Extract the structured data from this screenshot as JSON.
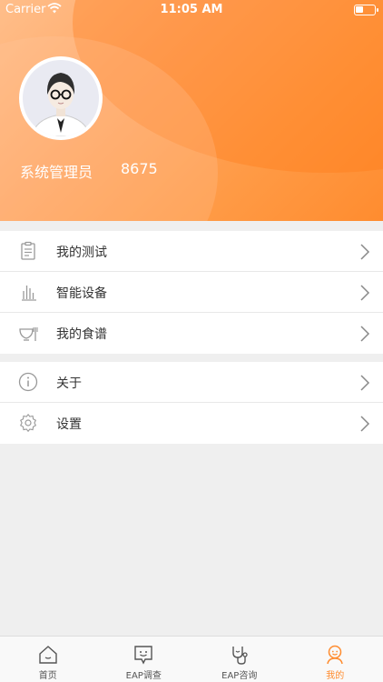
{
  "status_bar": {
    "carrier": "Carrier",
    "time": "11:05 AM"
  },
  "profile": {
    "name": "系统管理员",
    "id": "8675"
  },
  "menu": {
    "group1": [
      {
        "label": "我的测试",
        "icon": "clipboard-icon"
      },
      {
        "label": "智能设备",
        "icon": "bar-chart-icon"
      },
      {
        "label": "我的食谱",
        "icon": "bowl-icon"
      }
    ],
    "group2": [
      {
        "label": "关于",
        "icon": "info-icon"
      },
      {
        "label": "设置",
        "icon": "gear-icon"
      }
    ]
  },
  "tabs": [
    {
      "label": "首页",
      "icon": "home-icon",
      "active": false
    },
    {
      "label": "EAP调查",
      "icon": "survey-icon",
      "active": false
    },
    {
      "label": "EAP咨询",
      "icon": "stethoscope-icon",
      "active": false
    },
    {
      "label": "我的",
      "icon": "profile-icon",
      "active": true
    }
  ],
  "colors": {
    "accent": "#ff8c2f",
    "header_start": "#ffbe8a",
    "header_end": "#ff8c2f",
    "icon_gray": "#999999"
  }
}
